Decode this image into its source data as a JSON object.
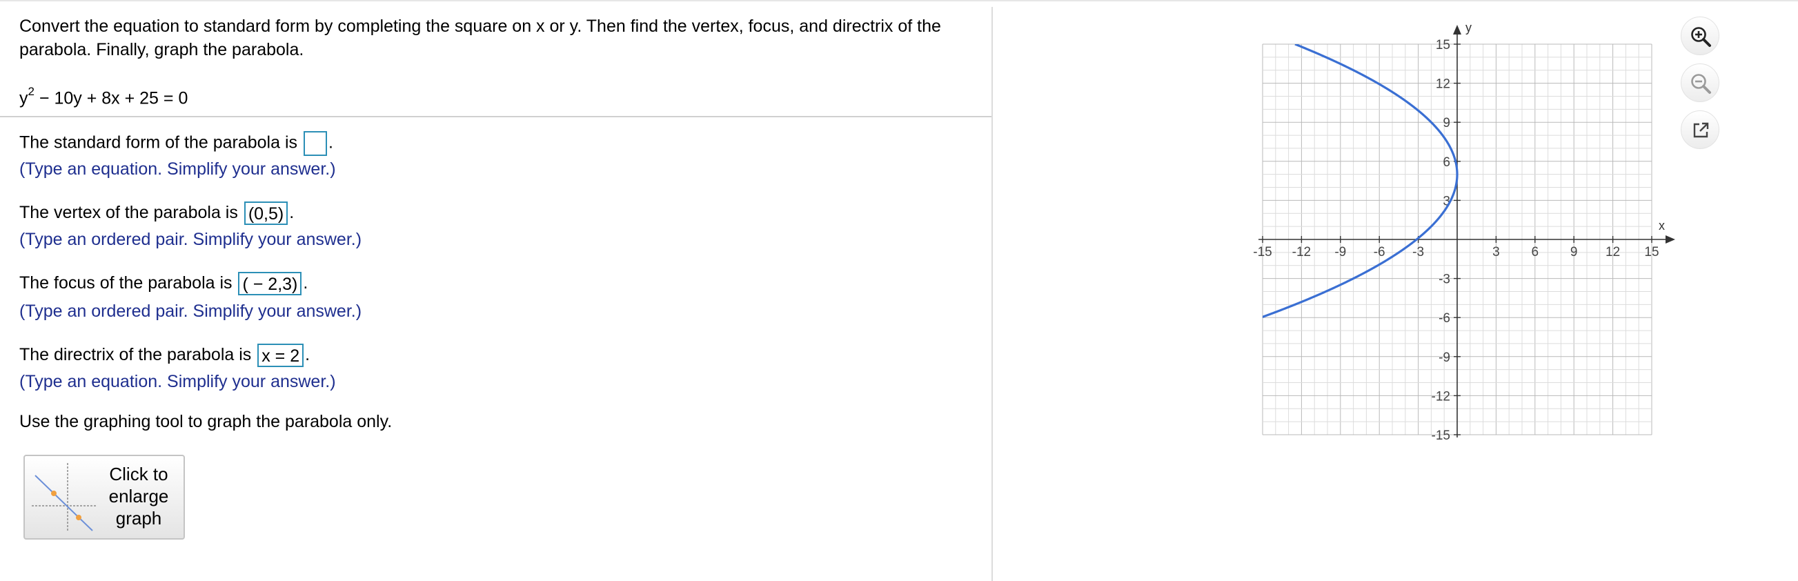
{
  "problem": {
    "line1": "Convert the equation to standard form by completing the square on x or y. Then find the vertex, focus, and directrix of the",
    "line2": "parabola. Finally, graph the parabola.",
    "equation_base": "y",
    "equation_exp": "2",
    "equation_rest": " − 10y + 8x + 25 = 0"
  },
  "answers": {
    "standard_form_prompt": "The standard form of the parabola is",
    "standard_form_value": "",
    "standard_form_hint": "(Type an equation. Simplify your answer.)",
    "vertex_prompt": "The vertex of the parabola is",
    "vertex_value": "(0,5)",
    "vertex_hint": "(Type an ordered pair. Simplify your answer.)",
    "focus_prompt": "The focus of the parabola is",
    "focus_value": "( − 2,3)",
    "focus_hint": "(Type an ordered pair. Simplify your answer.)",
    "directrix_prompt": "The directrix of the parabola is",
    "directrix_value": "x = 2",
    "directrix_hint": "(Type an equation. Simplify your answer.)",
    "period": ".",
    "graph_instruction": "Use the graphing tool to graph the parabola only."
  },
  "enlarge_button": {
    "label_line1": "Click to",
    "label_line2": "enlarge",
    "label_line3": "graph"
  },
  "toolbar": {
    "zoom_in": "zoom-in-icon",
    "zoom_out": "zoom-out-icon",
    "popout": "popout-icon"
  },
  "colors": {
    "curve": "#3a6fd3",
    "answer_box": "#2b8fb6",
    "hint_text": "#1f2f8f"
  },
  "chart_data": {
    "type": "line",
    "title": "",
    "xlabel": "x",
    "ylabel": "y",
    "xlim": [
      -15,
      15
    ],
    "ylim": [
      -15,
      15
    ],
    "grid": true,
    "minor_step": 1,
    "x_ticks": [
      -15,
      -12,
      -9,
      -6,
      -3,
      3,
      6,
      9,
      12,
      15
    ],
    "y_ticks": [
      -15,
      -12,
      -9,
      -6,
      -3,
      3,
      6,
      9,
      12,
      15
    ],
    "series": [
      {
        "equation": "x = -(y-5)^2/8",
        "y": [
          -6,
          -3,
          0,
          3,
          5,
          7,
          10,
          13,
          15
        ],
        "x": [
          -15.125,
          -8,
          -3.125,
          -0.5,
          0,
          -0.5,
          -3.125,
          -8,
          -12.5
        ]
      }
    ]
  }
}
